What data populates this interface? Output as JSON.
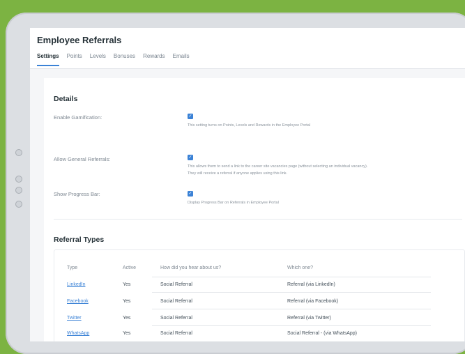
{
  "header": {
    "title": "Employee Referrals",
    "tabs": [
      {
        "label": "Settings",
        "active": true
      },
      {
        "label": "Points"
      },
      {
        "label": "Levels"
      },
      {
        "label": "Bonuses"
      },
      {
        "label": "Rewards"
      },
      {
        "label": "Emails"
      }
    ]
  },
  "details": {
    "title": "Details",
    "settings": [
      {
        "label": "Enable Gamification:",
        "checked": true,
        "description": "This setting turns on Points, Levels and Rewards in the Employee Portal"
      },
      {
        "label": "Allow General Referrals:",
        "checked": true,
        "description": "This allows them to send a link to the career site vacancies page (without selecting an individual vacancy).",
        "description2": "They will receive a referral if anyone applies using this link."
      },
      {
        "label": "Show Progress Bar:",
        "checked": true,
        "description": "Display Progress Bar on Referrals in Employee Portal"
      }
    ]
  },
  "referral_types": {
    "title": "Referral Types",
    "columns": [
      "Type",
      "Active",
      "How did you hear about us?",
      "Which one?"
    ],
    "rows": [
      {
        "type": "LinkedIn",
        "active": "Yes",
        "source": "Social Referral",
        "which": "Referral (via LinkedIn)"
      },
      {
        "type": "Facebook",
        "active": "Yes",
        "source": "Social Referral",
        "which": "Referral (via Facebook)"
      },
      {
        "type": "Twitter",
        "active": "Yes",
        "source": "Social Referral",
        "which": "Referral (via Twitter)"
      },
      {
        "type": "WhatsApp",
        "active": "Yes",
        "source": "Social Referral",
        "which": "Social Referral - (via WhatsApp)"
      }
    ]
  },
  "colors": {
    "background": "#7cb342",
    "accent": "#3b82d6",
    "tablet": "#dcdfe3"
  }
}
